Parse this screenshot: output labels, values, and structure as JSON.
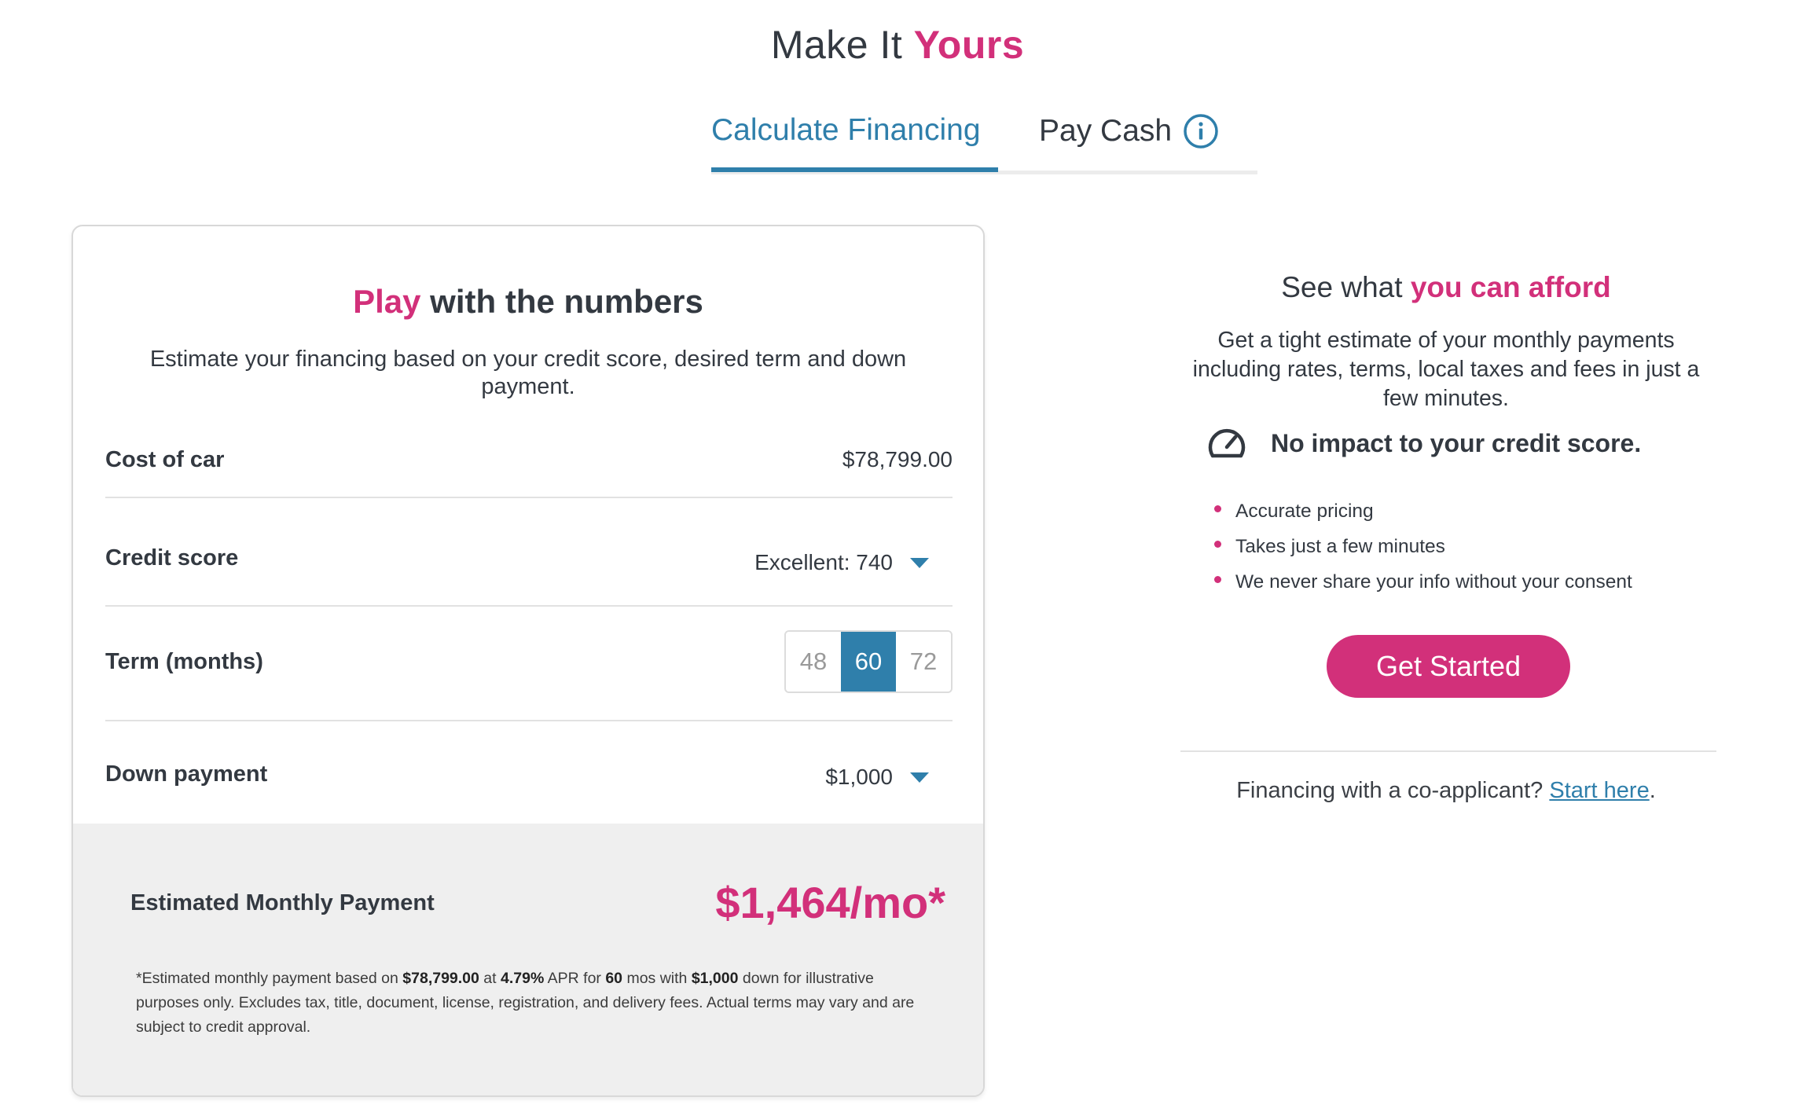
{
  "heading": {
    "prefix": "Make It",
    "accent": "Yours"
  },
  "tabs": [
    {
      "label": "Calculate Financing",
      "active": true
    },
    {
      "label": "Pay Cash",
      "active": false,
      "icon": "info-icon"
    }
  ],
  "card": {
    "title_accent": "Play",
    "title_rest": " with the numbers",
    "subtitle": "Estimate your financing based on your credit score, desired term and down payment.",
    "cost": {
      "label": "Cost of car",
      "value": "$78,799.00"
    },
    "credit": {
      "label": "Credit score",
      "value": "Excellent: 740",
      "icon": "caret-down-icon"
    },
    "term": {
      "label": "Term (months)",
      "options": [
        "48",
        "60",
        "72"
      ],
      "selected": "60"
    },
    "down": {
      "label": "Down payment",
      "value": "$1,000",
      "icon": "caret-down-icon"
    },
    "payment": {
      "label": "Estimated Monthly Payment",
      "value": "$1,464/mo*",
      "disclaimer": {
        "p1": "*Estimated monthly payment based on ",
        "price": "$78,799.00",
        "p2": " at ",
        "apr": "4.79%",
        "p3": " APR for ",
        "months": "60",
        "p4": " mos with ",
        "down": "$1,000",
        "p5": " down for illustrative purposes only. Excludes tax, title, document, license, registration, and delivery fees. Actual terms may vary and are subject to credit approval."
      }
    }
  },
  "afford": {
    "title_prefix": "See what ",
    "title_accent": "you can afford",
    "text": "Get a tight estimate of your monthly payments including rates, terms, local taxes and fees in just a few minutes.",
    "credit_note": "No impact to your credit score.",
    "credit_icon": "speedometer-icon",
    "bullets": [
      "Accurate pricing",
      "Takes just a few minutes",
      "We never share your info without your consent"
    ],
    "cta": "Get Started",
    "coapp_prefix": "Financing with a co-applicant? ",
    "coapp_link": "Start here",
    "coapp_suffix": "."
  },
  "colors": {
    "accent": "#d2307a",
    "primary": "#2f7fab",
    "text": "#333941",
    "panel": "#efefef"
  }
}
